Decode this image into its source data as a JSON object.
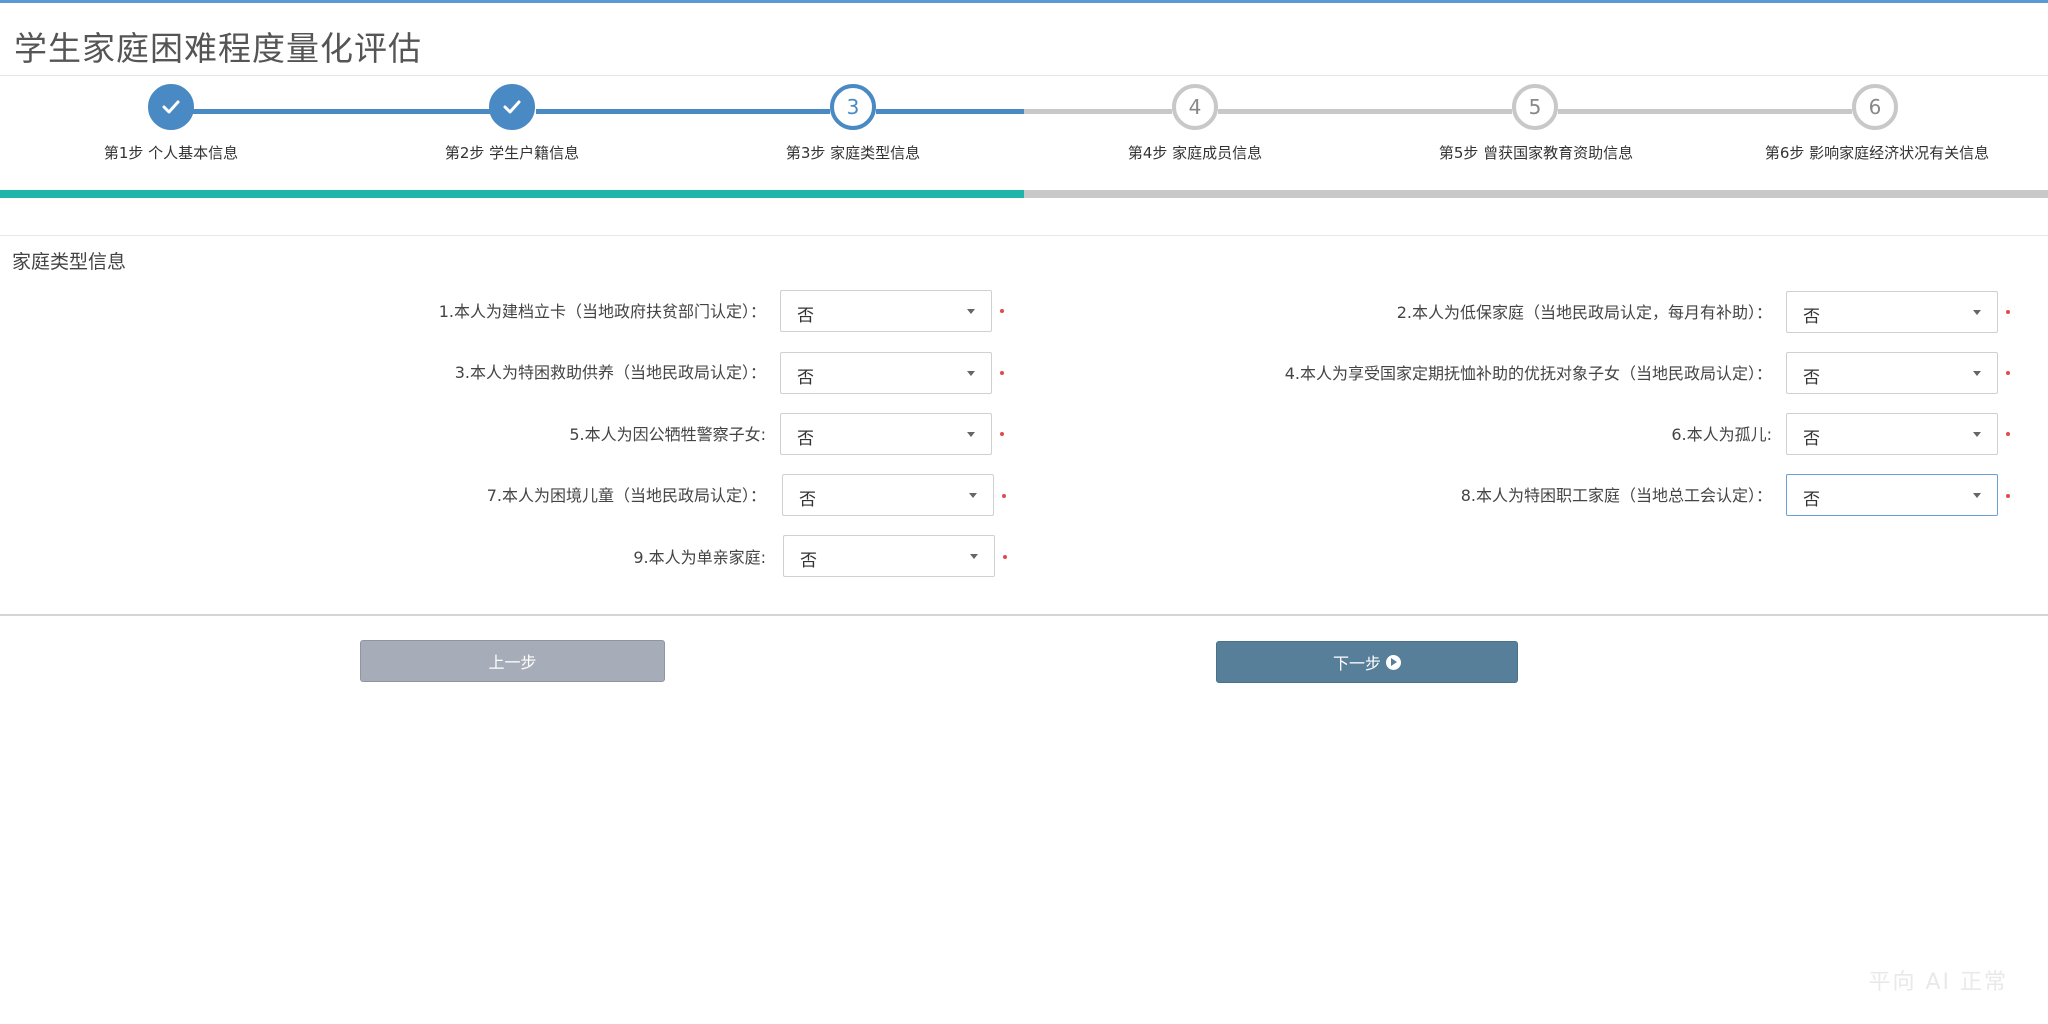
{
  "page": {
    "title": "学生家庭困难程度量化评估"
  },
  "wizard": {
    "steps": [
      {
        "number": "1",
        "label": "第1步 个人基本信息",
        "state": "done"
      },
      {
        "number": "2",
        "label": "第2步 学生户籍信息",
        "state": "done"
      },
      {
        "number": "3",
        "label": "第3步 家庭类型信息",
        "state": "active"
      },
      {
        "number": "4",
        "label": "第4步 家庭成员信息",
        "state": "todo"
      },
      {
        "number": "5",
        "label": "第5步 曾获国家教育资助信息",
        "state": "todo"
      },
      {
        "number": "6",
        "label": "第6步 影响家庭经济状况有关信息",
        "state": "todo"
      }
    ],
    "current_step": 3,
    "total_steps": 6
  },
  "section": {
    "title": "家庭类型信息"
  },
  "fields": [
    {
      "label": "1.本人为建档立卡（当地政府扶贫部门认定）：",
      "value": "否"
    },
    {
      "label": "2.本人为低保家庭（当地民政局认定，每月有补助）：",
      "value": "否"
    },
    {
      "label": "3.本人为特困救助供养（当地民政局认定）：",
      "value": "否"
    },
    {
      "label": "4.本人为享受国家定期抚恤补助的优抚对象子女（当地民政局认定）：",
      "value": "否"
    },
    {
      "label": "5.本人为因公牺牲警察子女:",
      "value": "否"
    },
    {
      "label": "6.本人为孤儿:",
      "value": "否"
    },
    {
      "label": "7.本人为困境儿童（当地民政局认定）：",
      "value": "否"
    },
    {
      "label": "8.本人为特困职工家庭（当地总工会认定）：",
      "value": "否"
    },
    {
      "label": "9.本人为单亲家庭:",
      "value": "否"
    }
  ],
  "buttons": {
    "prev": "上一步",
    "next": "下一步"
  },
  "watermark": "平向 AI 正常",
  "colors": {
    "accent": "#4a8ac4",
    "progress": "#1fb5a8",
    "required": "#e04b4b"
  }
}
